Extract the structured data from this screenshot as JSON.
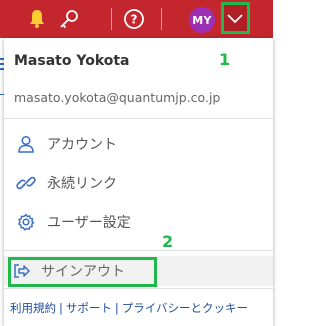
{
  "topbar": {
    "icons": [
      "bell-icon",
      "key-icon",
      "help-circle-icon",
      "chevron-down-icon"
    ],
    "avatar_initials": "MY",
    "bell_color": "#ffcc33",
    "background": "#c4262e"
  },
  "menu": {
    "user_name": "Masato Yokota",
    "user_email": "masato.yokota@quantumjp.co.jp",
    "items": [
      {
        "label": "アカウント",
        "icon": "user-icon"
      },
      {
        "label": "永続リンク",
        "icon": "link-icon"
      },
      {
        "label": "ユーザー設定",
        "icon": "gear-icon"
      }
    ],
    "signout": {
      "label": "サインアウト",
      "icon": "signout-icon"
    },
    "footer_links": [
      "利用規約",
      "サポート",
      "プライバシーとクッキー"
    ]
  },
  "annotations": {
    "label1": "1",
    "label2": "2",
    "color": "#1fb84a"
  }
}
